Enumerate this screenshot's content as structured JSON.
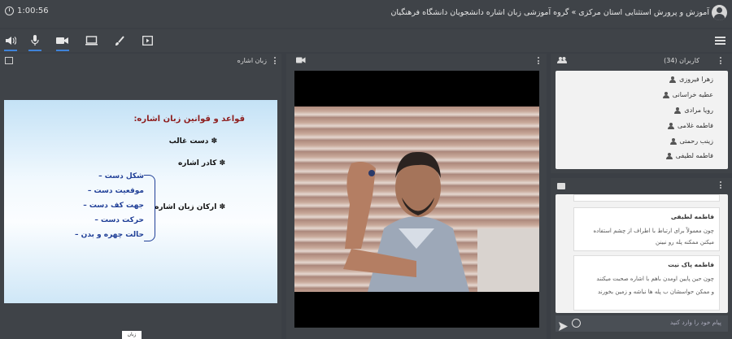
{
  "header": {
    "timer": "1:00:56",
    "title": "آموزش و پرورش استثنایی استان مرکزی » گروه آموزشی زبان اشاره دانشجویان دانشگاه فرهنگیان"
  },
  "toolbar": {
    "items": [
      "speaker-icon",
      "microphone-icon",
      "camera-icon",
      "screen-share-icon",
      "brush-icon",
      "play-media-icon"
    ],
    "menu": "menu-icon"
  },
  "presentation": {
    "label": "زبان اشاره",
    "slide": {
      "title": "قواعد و قوانین زبان اشاره:",
      "item1": "✽ دست غالب",
      "item2": "✽ کادر اشاره",
      "item3": "✽ ارکان زبان اشاره",
      "sub1": "شکل دست –",
      "sub2": "موقعیت دست –",
      "sub3": "جهت کف دست –",
      "sub4": "حرکت دست –",
      "sub5": "حالت چهره و بدن –"
    },
    "footer_tag": "زبان"
  },
  "users": {
    "header": "کاربران (34)",
    "list": [
      "زهرا فیروزی",
      "عطیه خراسانی",
      "رویا مرادی",
      "فاطمه غلامی",
      "زینب رحمتی",
      "فاطمه لطیفی"
    ]
  },
  "chat": {
    "messages": [
      {
        "name": "فاطمه لطیفی",
        "line1": "چون معمولاً برای ارتباط با اطراف از چشم استفاده",
        "line2": "میکنن ممکنه پله رو نبینن"
      },
      {
        "name": "فاطمه پاک نیت",
        "line1": "چون حین پایین اومدن باهم با اشاره صحبت میکنند",
        "line2": "و ممکن حواسشان ب پله ها نباشه و زمین بخورند"
      }
    ],
    "placeholder": "پیام خود را وارد کنید"
  },
  "colors": {
    "accent": "#3f83d9",
    "bg": "#3b3f45",
    "panel": "#3f4348"
  }
}
